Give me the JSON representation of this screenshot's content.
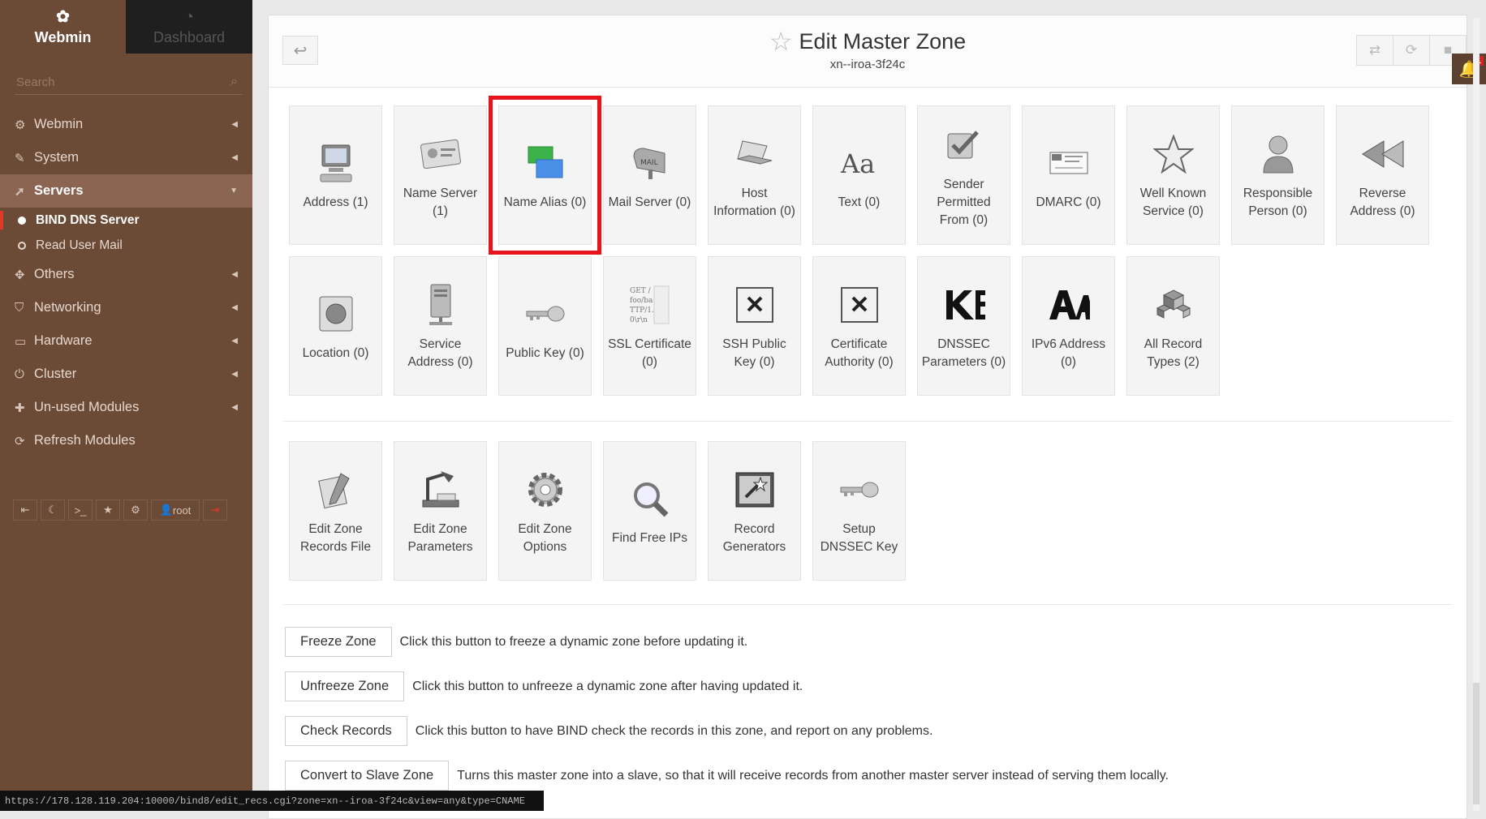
{
  "sidebar": {
    "tabs": {
      "webmin": "Webmin",
      "dashboard": "Dashboard"
    },
    "search_placeholder": "Search",
    "nav": [
      {
        "label": "Webmin"
      },
      {
        "label": "System"
      },
      {
        "label": "Servers"
      },
      {
        "label": "Others"
      },
      {
        "label": "Networking"
      },
      {
        "label": "Hardware"
      },
      {
        "label": "Cluster"
      },
      {
        "label": "Un-used Modules"
      },
      {
        "label": "Refresh Modules"
      }
    ],
    "sub_items": [
      {
        "label": "BIND DNS Server"
      },
      {
        "label": "Read User Mail"
      }
    ],
    "user": "root"
  },
  "header": {
    "title": "Edit Master Zone",
    "subtitle": "xn--iroa-3f24c"
  },
  "tiles_row1": [
    {
      "label": "Address (1)"
    },
    {
      "label": "Name Server (1)"
    },
    {
      "label": "Name Alias (0)"
    },
    {
      "label": "Mail Server (0)"
    },
    {
      "label": "Host Information (0)"
    },
    {
      "label": "Text (0)"
    },
    {
      "label": "Sender Permitted From (0)"
    },
    {
      "label": "DMARC (0)"
    },
    {
      "label": "Well Known Service (0)"
    },
    {
      "label": "Responsible Person (0)"
    },
    {
      "label": "Reverse Address (0)"
    }
  ],
  "tiles_row2": [
    {
      "label": "Location (0)"
    },
    {
      "label": "Service Address (0)"
    },
    {
      "label": "Public Key (0)"
    },
    {
      "label": "SSL Certificate (0)"
    },
    {
      "label": "SSH Public Key (0)"
    },
    {
      "label": "Certificate Authority (0)"
    },
    {
      "label": "DNSSEC Parameters (0)"
    },
    {
      "label": "IPv6 Address (0)"
    },
    {
      "label": "All Record Types (2)"
    }
  ],
  "tiles_row3": [
    {
      "label": "Edit Zone Records File"
    },
    {
      "label": "Edit Zone Parameters"
    },
    {
      "label": "Edit Zone Options"
    },
    {
      "label": "Find Free IPs"
    },
    {
      "label": "Record Generators"
    },
    {
      "label": "Setup DNSSEC Key"
    }
  ],
  "actions": [
    {
      "button": "Freeze Zone",
      "desc": "Click this button to freeze a dynamic zone before updating it."
    },
    {
      "button": "Unfreeze Zone",
      "desc": "Click this button to unfreeze a dynamic zone after having updated it."
    },
    {
      "button": "Check Records",
      "desc": "Click this button to have BIND check the records in this zone, and report on any problems."
    },
    {
      "button": "Convert to Slave Zone",
      "desc": "Turns this master zone into a slave, so that it will receive records from another master server instead of serving them locally."
    }
  ],
  "status_url": "https://178.128.119.204:10000/bind8/edit_recs.cgi?zone=xn--iroa-3f24c&view=any&type=CNAME",
  "notification_count": "1",
  "colors": {
    "sidebar": "#6b4a36",
    "accent_red": "#e8141d",
    "highlight_tile": "Name Alias (0)"
  }
}
